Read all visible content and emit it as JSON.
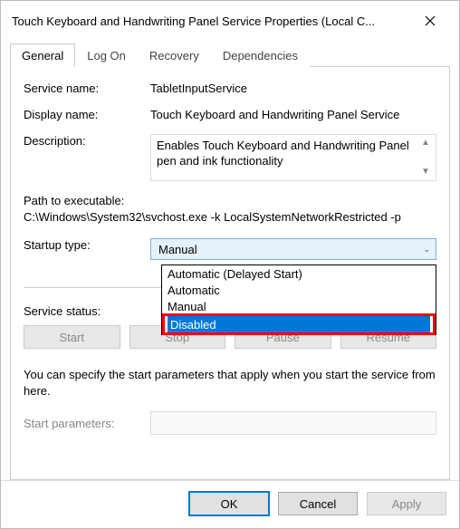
{
  "title": "Touch Keyboard and Handwriting Panel Service Properties (Local C...",
  "tabs": {
    "general": "General",
    "logon": "Log On",
    "recovery": "Recovery",
    "deps": "Dependencies"
  },
  "labels": {
    "service_name": "Service name:",
    "display_name": "Display name:",
    "description": "Description:",
    "path": "Path to executable:",
    "startup_type": "Startup type:",
    "service_status": "Service status:",
    "start_params": "Start parameters:"
  },
  "values": {
    "service_name": "TabletInputService",
    "display_name": "Touch Keyboard and Handwriting Panel Service",
    "description": "Enables Touch Keyboard and Handwriting Panel pen and ink functionality",
    "path": "C:\\Windows\\System32\\svchost.exe -k LocalSystemNetworkRestricted -p",
    "startup_selected": "Manual"
  },
  "startup_options": {
    "auto_delayed": "Automatic (Delayed Start)",
    "automatic": "Automatic",
    "manual": "Manual",
    "disabled": "Disabled"
  },
  "buttons": {
    "start": "Start",
    "stop": "Stop",
    "pause": "Pause",
    "resume": "Resume",
    "ok": "OK",
    "cancel": "Cancel",
    "apply": "Apply"
  },
  "hint": "You can specify the start parameters that apply when you start the service from here."
}
